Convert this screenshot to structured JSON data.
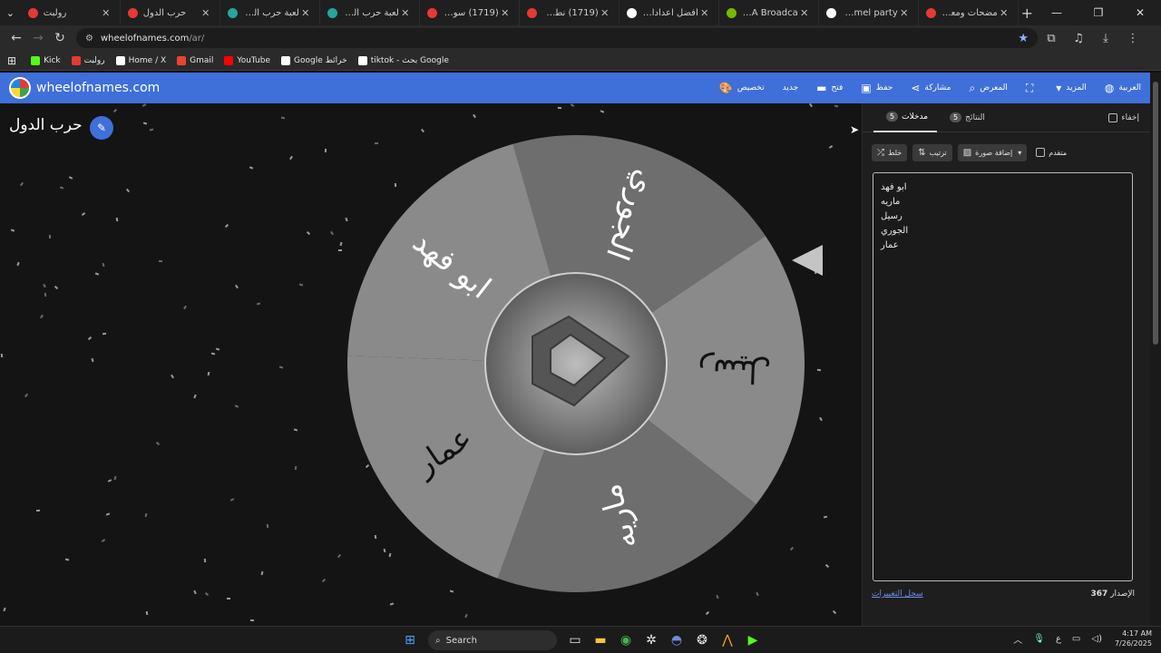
{
  "browser": {
    "tabs": [
      {
        "title": "رولبت",
        "color": "#e53935"
      },
      {
        "title": "حرب الدول",
        "color": "#e53935"
      },
      {
        "title": "لعبة حرب الفواكه",
        "color": "#26a69a"
      },
      {
        "title": "لعبة حرب الدول |",
        "color": "#26a69a"
      },
      {
        "title": "(1719) سويت أكبر",
        "color": "#e53935"
      },
      {
        "title": "(1719) نطق أغنية",
        "color": "#e53935"
      },
      {
        "title": "أفضل اعدادات x",
        "color": "#ffffff"
      },
      {
        "title": "NVIDIA Broadca...",
        "color": "#76b900"
      },
      {
        "title": "pummel party - ...",
        "color": "#ffffff"
      },
      {
        "title": "مضحات ومعالج...",
        "color": "#e53935"
      }
    ],
    "url_domain": "wheelofnames.com",
    "url_path": "/ar/",
    "bookmarks": [
      {
        "label": "Kick",
        "color": "#53fc18"
      },
      {
        "label": "رولبت",
        "color": "#e53935"
      },
      {
        "label": "Home / X",
        "color": "#ffffff"
      },
      {
        "label": "Gmail",
        "color": "#ea4335"
      },
      {
        "label": "YouTube",
        "color": "#ff0000"
      },
      {
        "label": "Google خرائط",
        "color": "#ffffff"
      },
      {
        "label": "tiktok - بحث Google",
        "color": "#ffffff"
      }
    ]
  },
  "app": {
    "site_name": "wheelofnames.com",
    "menu": {
      "customize": "تخصيص",
      "new": "جديد",
      "open": "فتح",
      "save": "حفظ",
      "share": "مشاركة",
      "gallery": "المعرض",
      "more": "المزيد",
      "language": "العربية"
    },
    "accent_color": "#3f6fd9"
  },
  "wheel": {
    "title": "حرب الدول",
    "segments": [
      {
        "name": "الجوري",
        "color": "#6e6e6e"
      },
      {
        "name": "رسيل",
        "color": "#8a8a8a"
      },
      {
        "name": "ماريه",
        "color": "#6e6e6e"
      },
      {
        "name": "عمار",
        "color": "#8a8a8a"
      },
      {
        "name": "ابو فهد",
        "color": "#8a8a8a"
      }
    ]
  },
  "panel": {
    "tab_entries": "مدخلات",
    "tab_entries_count": "5",
    "tab_results": "النتائج",
    "tab_results_count": "5",
    "hide_label": "إخفاء",
    "shuffle_label": "خلط",
    "sort_label": "ترتيب",
    "add_image_label": "إضافة صورة",
    "advanced_label": "متقدم",
    "entries": [
      "ابو فهد",
      "ماريه",
      "رسيل",
      "الجوري",
      "عمار"
    ],
    "changelog_label": "سجل التغييرات",
    "version_label": "الإصدار",
    "version_number": "367"
  },
  "taskbar": {
    "search_label": "Search",
    "lang": "ع",
    "time": "4:17 AM",
    "date": "7/26/2025"
  }
}
